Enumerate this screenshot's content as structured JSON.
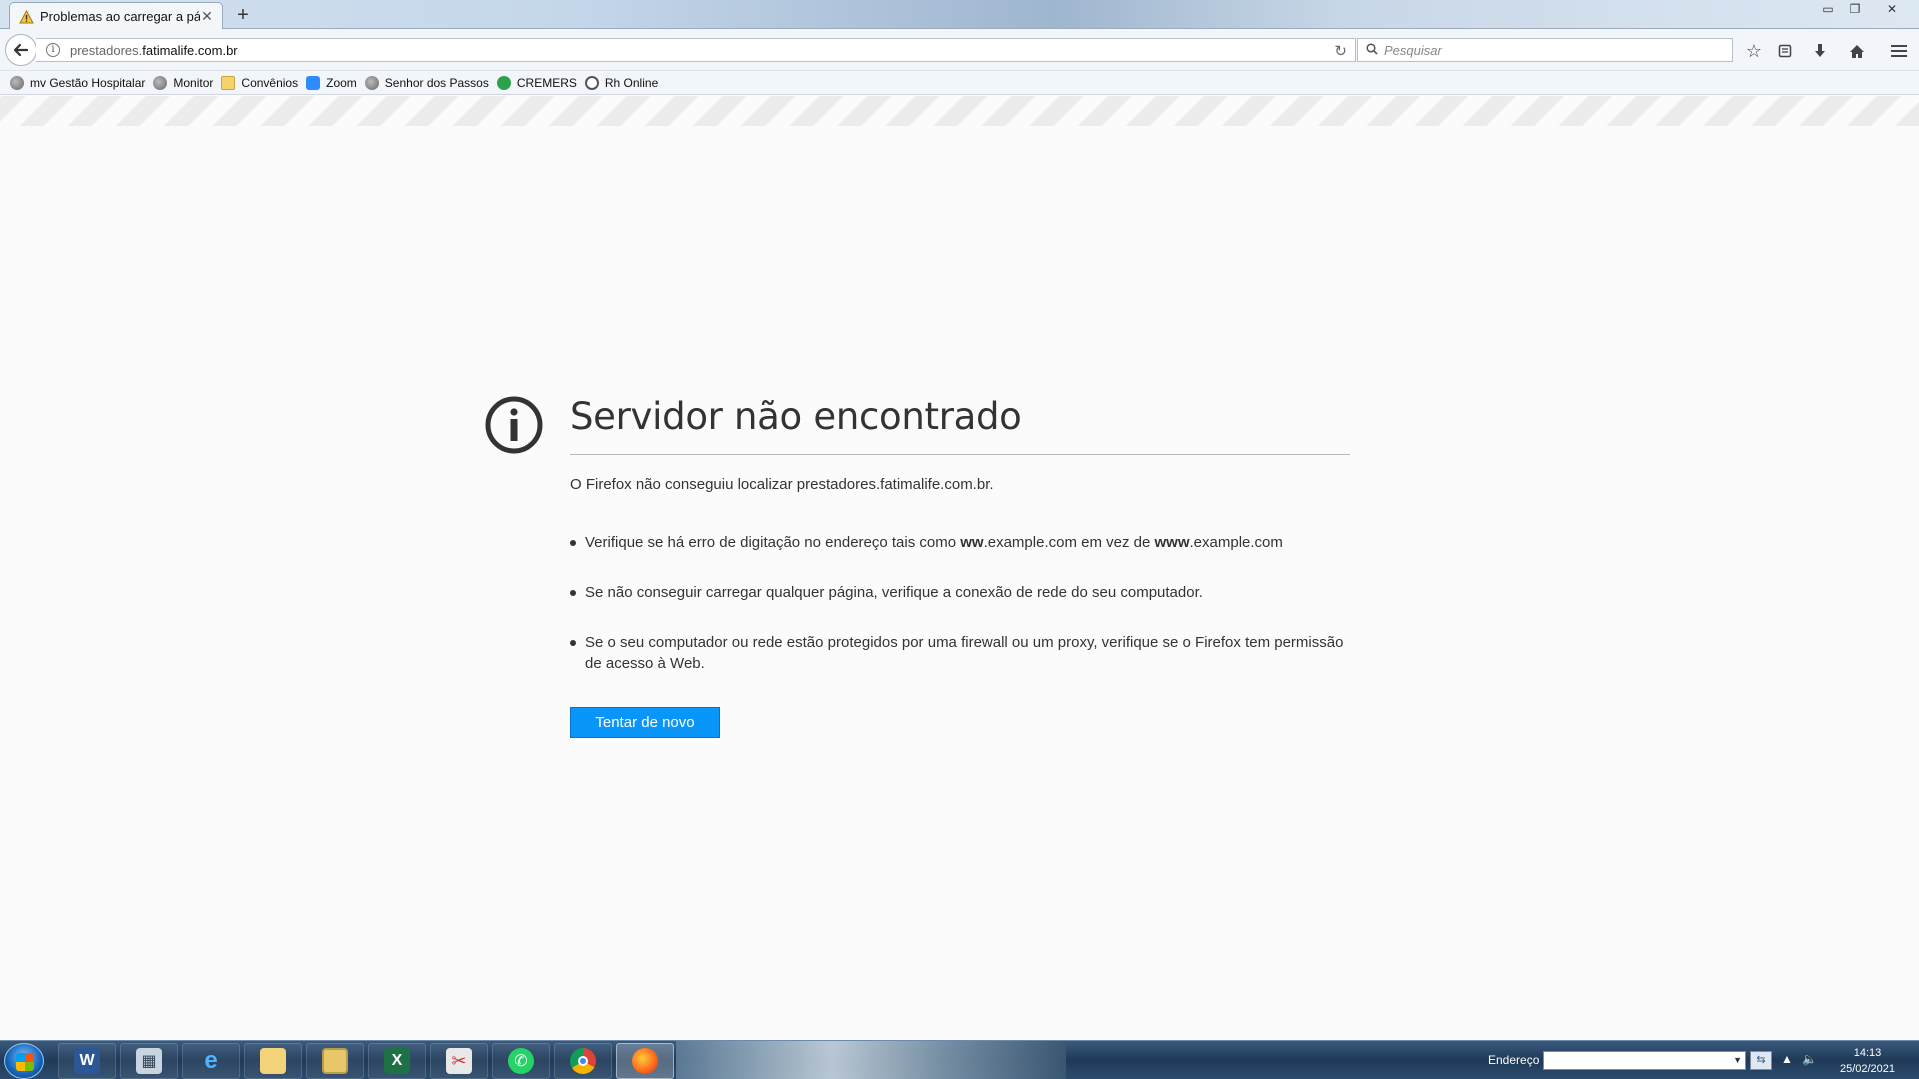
{
  "browser": {
    "tab_title": "Problemas ao carregar a pági",
    "new_tab_label": "+",
    "url_prefix": "prestadores.",
    "url_domain": "fatimalife.com.br",
    "search_placeholder": "Pesquisar"
  },
  "bookmarks": [
    {
      "label": "mv Gestão Hospitalar",
      "icon": "globe-icon"
    },
    {
      "label": "Monitor",
      "icon": "globe-icon"
    },
    {
      "label": "Convênios",
      "icon": "folder-icon"
    },
    {
      "label": "Zoom",
      "icon": "zoom-icon"
    },
    {
      "label": "Senhor dos Passos",
      "icon": "globe-icon"
    },
    {
      "label": "CREMERS",
      "icon": "shield-icon"
    },
    {
      "label": "Rh Online",
      "icon": "rh-icon"
    }
  ],
  "error": {
    "title": "Servidor não encontrado",
    "description": "O Firefox não conseguiu localizar prestadores.fatimalife.com.br.",
    "tip1_a": "Verifique se há erro de digitação no endereço tais como ",
    "tip1_b1": "ww",
    "tip1_c": ".example.com em vez de ",
    "tip1_b2": "www",
    "tip1_d": ".example.com",
    "tip2": "Se não conseguir carregar qualquer página, verifique a conexão de rede  do seu computador.",
    "tip3": "Se o seu computador ou rede estão protegidos por uma firewall ou um proxy, verifique se o Firefox tem permissão de acesso à Web.",
    "retry_label": "Tentar de novo"
  },
  "taskbar": {
    "address_label": "Endereço",
    "time": "14:13",
    "date": "25/02/2021",
    "apps": [
      "word-icon",
      "calculator-icon",
      "internet-explorer-icon",
      "folder-icon",
      "file-explorer-icon",
      "excel-icon",
      "snipping-tool-icon",
      "whatsapp-icon",
      "chrome-icon",
      "firefox-icon"
    ]
  },
  "colors": {
    "accent": "#0996f8",
    "title_text": "#333333"
  }
}
